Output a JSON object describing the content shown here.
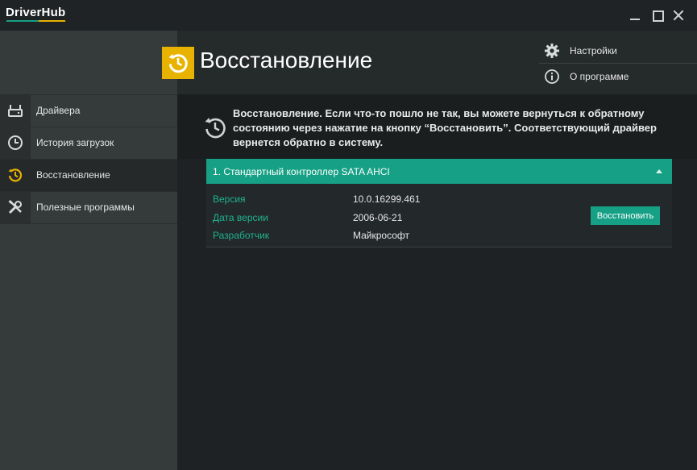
{
  "app": {
    "title": "DriverHub"
  },
  "header": {
    "title": "Восстановление",
    "links": [
      {
        "label": "Настройки",
        "icon": "gear-icon"
      },
      {
        "label": "О программе",
        "icon": "info-icon"
      }
    ]
  },
  "sidebar": {
    "items": [
      {
        "label": "Драйвера",
        "icon": "drive-icon",
        "active": false
      },
      {
        "label": "История загрузок",
        "icon": "clock-icon",
        "active": false
      },
      {
        "label": "Восстановление",
        "icon": "restore-icon",
        "active": true
      },
      {
        "label": "Полезные программы",
        "icon": "tools-icon",
        "active": false
      }
    ]
  },
  "info": {
    "text": "Восстановление. Если что-то пошло не так, вы можете вернуться к обратному состоянию через нажатие на кнопку “Восстановить”. Соответствующий драйвер вернется обратно в систему."
  },
  "driver": {
    "title": "1. Стандартный контроллер SATA AHCI",
    "fields": [
      {
        "label": "Версия",
        "value": "10.0.16299.461"
      },
      {
        "label": "Дата версии",
        "value": "2006-06-21"
      },
      {
        "label": "Разработчик",
        "value": "Майкрософт"
      }
    ],
    "restore_label": "Восстановить"
  },
  "colors": {
    "accent": "#16a085",
    "highlight": "#e8b200",
    "sidebar": "#353a3b",
    "background": "#1e2224"
  }
}
